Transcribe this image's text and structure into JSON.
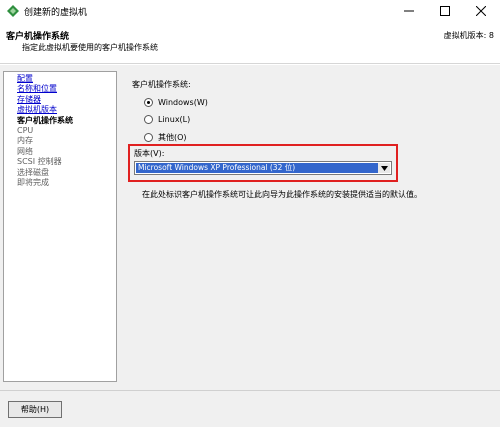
{
  "window": {
    "title": "创建新的虚拟机"
  },
  "header": {
    "title": "客户机操作系统",
    "subtitle": "指定此虚拟机要使用的客户机操作系统",
    "version": "虚拟机版本: 8"
  },
  "nav": {
    "items": [
      {
        "label": "配置",
        "state": "link"
      },
      {
        "label": "名称和位置",
        "state": "link"
      },
      {
        "label": "存储器",
        "state": "link"
      },
      {
        "label": "虚拟机版本",
        "state": "link"
      },
      {
        "label": "客户机操作系统",
        "state": "current"
      },
      {
        "label": "CPU",
        "state": "future"
      },
      {
        "label": "内存",
        "state": "future"
      },
      {
        "label": "网络",
        "state": "future"
      },
      {
        "label": "SCSI 控制器",
        "state": "future"
      },
      {
        "label": "选择磁盘",
        "state": "future"
      },
      {
        "label": "即将完成",
        "state": "future"
      }
    ]
  },
  "guest_os": {
    "label": "客户机操作系统:",
    "options": [
      {
        "label": "Windows(W)",
        "checked": true
      },
      {
        "label": "Linux(L)",
        "checked": false
      },
      {
        "label": "其他(O)",
        "checked": false
      }
    ]
  },
  "version": {
    "label": "版本(V):",
    "selected": "Microsoft Windows XP Professional (32 位)"
  },
  "description": "在此处标识客户机操作系统可让此向导为此操作系统的安装提供适当的默认值。",
  "footer": {
    "help_label": "帮助(H)"
  },
  "colors": {
    "highlight_border": "#e02020",
    "selection": "#3366cc",
    "link": "#0000cc"
  }
}
